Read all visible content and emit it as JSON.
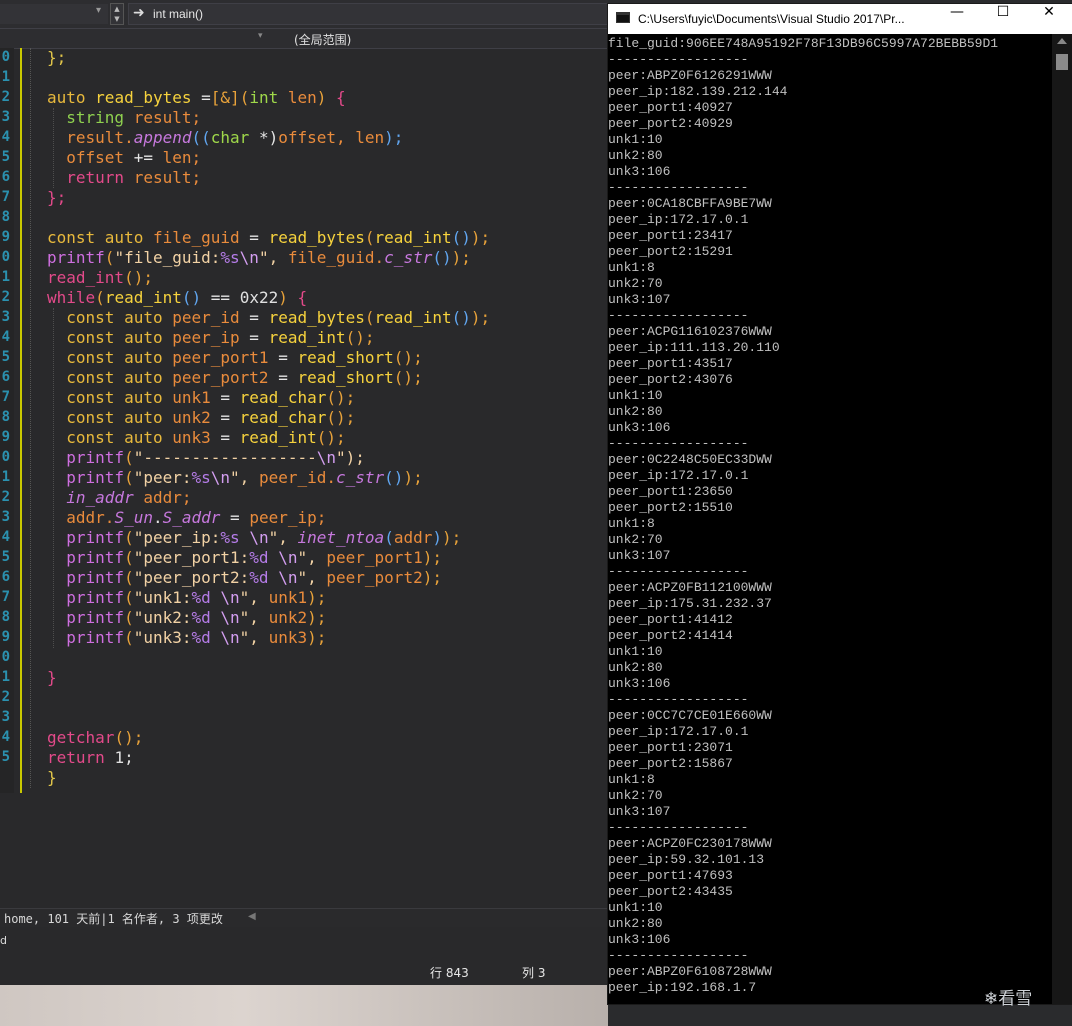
{
  "ide": {
    "nav_member": "int main()",
    "scope": "(全局范围)",
    "line_numbers": [
      "0",
      "1",
      "2",
      "3",
      "4",
      "5",
      "6",
      "7",
      "8",
      "9",
      "0",
      "1",
      "2",
      "3",
      "4",
      "5",
      "6",
      "7",
      "8",
      "9",
      "0",
      "1",
      "2",
      "3",
      "4",
      "5",
      "6",
      "7",
      "8",
      "9",
      "0",
      "1",
      "2",
      "3",
      "4",
      "5"
    ],
    "status_blame": "home, 101 天前|1 名作者, 3 项更改",
    "status_small": "d",
    "line_label": "行 843",
    "col_label": "列 3"
  },
  "console": {
    "title": "C:\\Users\\fuyic\\Documents\\Visual Studio 2017\\Pr...",
    "minimize": "—",
    "maximize": "☐",
    "close": "✕",
    "lines": [
      "file_guid:906EE748A95192F78F13DB96C5997A72BEBB59D1",
      "------------------",
      "peer:ABPZ0F6126291WWW",
      "peer_ip:182.139.212.144",
      "peer_port1:40927",
      "peer_port2:40929",
      "unk1:10",
      "unk2:80",
      "unk3:106",
      "------------------",
      "peer:0CA18CBFFA9BE7WW",
      "peer_ip:172.17.0.1",
      "peer_port1:23417",
      "peer_port2:15291",
      "unk1:8",
      "unk2:70",
      "unk3:107",
      "------------------",
      "peer:ACPG116102376WWW",
      "peer_ip:111.113.20.110",
      "peer_port1:43517",
      "peer_port2:43076",
      "unk1:10",
      "unk2:80",
      "unk3:106",
      "------------------",
      "peer:0C2248C50EC33DWW",
      "peer_ip:172.17.0.1",
      "peer_port1:23650",
      "peer_port2:15510",
      "unk1:8",
      "unk2:70",
      "unk3:107",
      "------------------",
      "peer:ACPZ0FB112100WWW",
      "peer_ip:175.31.232.37",
      "peer_port1:41412",
      "peer_port2:41414",
      "unk1:10",
      "unk2:80",
      "unk3:106",
      "------------------",
      "peer:0CC7C7CE01E660WW",
      "peer_ip:172.17.0.1",
      "peer_port1:23071",
      "peer_port2:15867",
      "unk1:8",
      "unk2:70",
      "unk3:107",
      "------------------",
      "peer:ACPZ0FC230178WWW",
      "peer_ip:59.32.101.13",
      "peer_port1:47693",
      "peer_port2:43435",
      "unk1:10",
      "unk2:80",
      "unk3:106",
      "------------------",
      "peer:ABPZ0F6108728WWW",
      "peer_ip:192.168.1.7"
    ]
  },
  "watermark": "看雪",
  "code": [
    [
      [
        "};",
        "p1"
      ]
    ],
    [],
    [
      [
        "auto ",
        "k"
      ],
      [
        "read_bytes ",
        "f"
      ],
      [
        "=",
        "op"
      ],
      [
        "[&]",
        "p2"
      ],
      [
        "(",
        "p2"
      ],
      [
        "int ",
        "t"
      ],
      [
        "len",
        "s"
      ],
      [
        ") ",
        "p2"
      ],
      [
        "{",
        "kp"
      ]
    ],
    [
      [
        "  string ",
        "tf"
      ],
      [
        "result;",
        "s"
      ]
    ],
    [
      [
        "  result.",
        "s"
      ],
      [
        "append",
        "fi"
      ],
      [
        "((",
        "p3"
      ],
      [
        "char ",
        "t"
      ],
      [
        "*)",
        "op"
      ],
      [
        "offset, ",
        "s"
      ],
      [
        "len",
        "s"
      ],
      [
        ");",
        "p3"
      ]
    ],
    [
      [
        "  offset ",
        "s"
      ],
      [
        "+= ",
        "op"
      ],
      [
        "len;",
        "s"
      ]
    ],
    [
      [
        "  return ",
        "kp"
      ],
      [
        "result;",
        "s"
      ]
    ],
    [
      [
        "};",
        "kp"
      ]
    ],
    [],
    [
      [
        "const auto ",
        "k"
      ],
      [
        "file_guid ",
        "s"
      ],
      [
        "= ",
        "op"
      ],
      [
        "read_bytes",
        "f"
      ],
      [
        "(",
        "p2"
      ],
      [
        "read_int",
        "f"
      ],
      [
        "()",
        "p3"
      ],
      [
        ");",
        "p2"
      ]
    ],
    [
      [
        "printf",
        "sp"
      ],
      [
        "(",
        "p2"
      ],
      [
        "\"file_guid:",
        "str"
      ],
      [
        "%s",
        "fm"
      ],
      [
        "\\n",
        "esc"
      ],
      [
        "\", ",
        "str"
      ],
      [
        "file_guid.",
        "s"
      ],
      [
        "c_str",
        "fi"
      ],
      [
        "()",
        "p3"
      ],
      [
        ");",
        "p2"
      ]
    ],
    [
      [
        "read_int",
        "kp"
      ],
      [
        "();",
        "p2"
      ]
    ],
    [
      [
        "while",
        "kp"
      ],
      [
        "(",
        "p2"
      ],
      [
        "read_int",
        "f"
      ],
      [
        "() ",
        "p3"
      ],
      [
        "== ",
        "op"
      ],
      [
        "0x22",
        "n"
      ],
      [
        ") ",
        "p2"
      ],
      [
        "{",
        "kp"
      ]
    ],
    [
      [
        "  const auto ",
        "k"
      ],
      [
        "peer_id ",
        "s"
      ],
      [
        "= ",
        "op"
      ],
      [
        "read_bytes",
        "f"
      ],
      [
        "(",
        "p2"
      ],
      [
        "read_int",
        "f"
      ],
      [
        "()",
        "p3"
      ],
      [
        ");",
        "p2"
      ]
    ],
    [
      [
        "  const auto ",
        "k"
      ],
      [
        "peer_ip ",
        "s"
      ],
      [
        "= ",
        "op"
      ],
      [
        "read_int",
        "f"
      ],
      [
        "();",
        "p2"
      ]
    ],
    [
      [
        "  const auto ",
        "k"
      ],
      [
        "peer_port1 ",
        "s"
      ],
      [
        "= ",
        "op"
      ],
      [
        "read_short",
        "f"
      ],
      [
        "();",
        "p2"
      ]
    ],
    [
      [
        "  const auto ",
        "k"
      ],
      [
        "peer_port2 ",
        "s"
      ],
      [
        "= ",
        "op"
      ],
      [
        "read_short",
        "f"
      ],
      [
        "();",
        "p2"
      ]
    ],
    [
      [
        "  const auto ",
        "k"
      ],
      [
        "unk1 ",
        "s"
      ],
      [
        "= ",
        "op"
      ],
      [
        "read_char",
        "f"
      ],
      [
        "();",
        "p2"
      ]
    ],
    [
      [
        "  const auto ",
        "k"
      ],
      [
        "unk2 ",
        "s"
      ],
      [
        "= ",
        "op"
      ],
      [
        "read_char",
        "f"
      ],
      [
        "();",
        "p2"
      ]
    ],
    [
      [
        "  const auto ",
        "k"
      ],
      [
        "unk3 ",
        "s"
      ],
      [
        "= ",
        "op"
      ],
      [
        "read_int",
        "f"
      ],
      [
        "();",
        "p2"
      ]
    ],
    [
      [
        "  printf",
        "sp"
      ],
      [
        "(",
        "p2"
      ],
      [
        "\"------------------",
        "str"
      ],
      [
        "\\n",
        "esc"
      ],
      [
        "\");",
        "str"
      ]
    ],
    [
      [
        "  printf",
        "sp"
      ],
      [
        "(",
        "p2"
      ],
      [
        "\"peer:",
        "str"
      ],
      [
        "%s",
        "fm"
      ],
      [
        "\\n",
        "esc"
      ],
      [
        "\", ",
        "str"
      ],
      [
        "peer_id.",
        "s"
      ],
      [
        "c_str",
        "fi"
      ],
      [
        "()",
        "p3"
      ],
      [
        ");",
        "p2"
      ]
    ],
    [
      [
        "  in_addr ",
        "fi"
      ],
      [
        "addr;",
        "s"
      ]
    ],
    [
      [
        "  addr.",
        "s"
      ],
      [
        "S_un",
        "fi"
      ],
      [
        ".",
        "op"
      ],
      [
        "S_addr ",
        "fi"
      ],
      [
        "= ",
        "op"
      ],
      [
        "peer_ip;",
        "s"
      ]
    ],
    [
      [
        "  printf",
        "sp"
      ],
      [
        "(",
        "p2"
      ],
      [
        "\"peer_ip:",
        "str"
      ],
      [
        "%s ",
        "fm"
      ],
      [
        "\\n",
        "esc"
      ],
      [
        "\", ",
        "str"
      ],
      [
        "inet_ntoa",
        "fi"
      ],
      [
        "(",
        "p3"
      ],
      [
        "addr",
        "s"
      ],
      [
        ")",
        "p3"
      ],
      [
        ");",
        "p2"
      ]
    ],
    [
      [
        "  printf",
        "sp"
      ],
      [
        "(",
        "p2"
      ],
      [
        "\"peer_port1:",
        "str"
      ],
      [
        "%d ",
        "fm"
      ],
      [
        "\\n",
        "esc"
      ],
      [
        "\", ",
        "str"
      ],
      [
        "peer_port1",
        "s"
      ],
      [
        ");",
        "p2"
      ]
    ],
    [
      [
        "  printf",
        "sp"
      ],
      [
        "(",
        "p2"
      ],
      [
        "\"peer_port2:",
        "str"
      ],
      [
        "%d ",
        "fm"
      ],
      [
        "\\n",
        "esc"
      ],
      [
        "\", ",
        "str"
      ],
      [
        "peer_port2",
        "s"
      ],
      [
        ");",
        "p2"
      ]
    ],
    [
      [
        "  printf",
        "sp"
      ],
      [
        "(",
        "p2"
      ],
      [
        "\"unk1:",
        "str"
      ],
      [
        "%d ",
        "fm"
      ],
      [
        "\\n",
        "esc"
      ],
      [
        "\", ",
        "str"
      ],
      [
        "unk1",
        "s"
      ],
      [
        ");",
        "p2"
      ]
    ],
    [
      [
        "  printf",
        "sp"
      ],
      [
        "(",
        "p2"
      ],
      [
        "\"unk2:",
        "str"
      ],
      [
        "%d ",
        "fm"
      ],
      [
        "\\n",
        "esc"
      ],
      [
        "\", ",
        "str"
      ],
      [
        "unk2",
        "s"
      ],
      [
        ");",
        "p2"
      ]
    ],
    [
      [
        "  printf",
        "sp"
      ],
      [
        "(",
        "p2"
      ],
      [
        "\"unk3:",
        "str"
      ],
      [
        "%d ",
        "fm"
      ],
      [
        "\\n",
        "esc"
      ],
      [
        "\", ",
        "str"
      ],
      [
        "unk3",
        "s"
      ],
      [
        ");",
        "p2"
      ]
    ],
    [],
    [
      [
        "}",
        "kp"
      ]
    ],
    [],
    [],
    [
      [
        "getchar",
        "kp"
      ],
      [
        "();",
        "p2"
      ]
    ],
    [
      [
        "return ",
        "kp"
      ],
      [
        "1;",
        "n"
      ]
    ],
    [
      [
        "}",
        "p1"
      ]
    ]
  ]
}
